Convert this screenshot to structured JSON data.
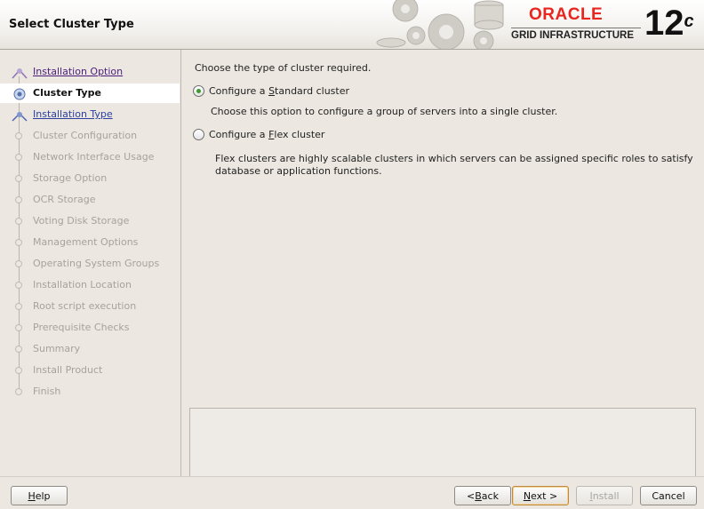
{
  "window": {
    "title": "Select Cluster Type",
    "brand": "ORACLE",
    "product": "GRID INFRASTRUCTURE",
    "version": "12",
    "version_suffix": "c"
  },
  "steps": [
    {
      "label": "Installation Option",
      "state": "visited"
    },
    {
      "label": "Cluster Type",
      "state": "current"
    },
    {
      "label": "Installation Type",
      "state": "link"
    },
    {
      "label": "Cluster Configuration",
      "state": "disabled"
    },
    {
      "label": "Network Interface Usage",
      "state": "disabled"
    },
    {
      "label": "Storage Option",
      "state": "disabled"
    },
    {
      "label": "OCR Storage",
      "state": "disabled"
    },
    {
      "label": "Voting Disk Storage",
      "state": "disabled"
    },
    {
      "label": "Management Options",
      "state": "disabled"
    },
    {
      "label": "Operating System Groups",
      "state": "disabled"
    },
    {
      "label": "Installation Location",
      "state": "disabled"
    },
    {
      "label": "Root script execution",
      "state": "disabled"
    },
    {
      "label": "Prerequisite Checks",
      "state": "disabled"
    },
    {
      "label": "Summary",
      "state": "disabled"
    },
    {
      "label": "Install Product",
      "state": "disabled"
    },
    {
      "label": "Finish",
      "state": "disabled"
    }
  ],
  "main": {
    "prompt": "Choose the type of cluster required.",
    "options": [
      {
        "pre": "Configure a ",
        "mnemonic": "S",
        "post": "tandard cluster",
        "selected": true,
        "description": "Choose this option to configure a group of servers into a single cluster."
      },
      {
        "pre": "Configure a ",
        "mnemonic": "F",
        "post": "lex cluster",
        "selected": false,
        "description_lines": [
          "Flex clusters are highly scalable clusters in which servers can be assigned specific roles to satisfy",
          "database or application functions."
        ]
      }
    ]
  },
  "buttons": {
    "help": {
      "mnemonic": "H",
      "rest": "elp"
    },
    "back": {
      "pre": "< ",
      "mnemonic": "B",
      "rest": "ack"
    },
    "next": {
      "mnemonic": "N",
      "rest": "ext >"
    },
    "install": {
      "mnemonic": "I",
      "rest": "nstall"
    },
    "cancel": {
      "label": "Cancel"
    }
  },
  "colors": {
    "brand_red": "#e8261f",
    "radio_selected": "#3e9a2e",
    "link": "#2a3f9e",
    "visited": "#4a1d7a",
    "disabled_text": "#a6a29c"
  }
}
